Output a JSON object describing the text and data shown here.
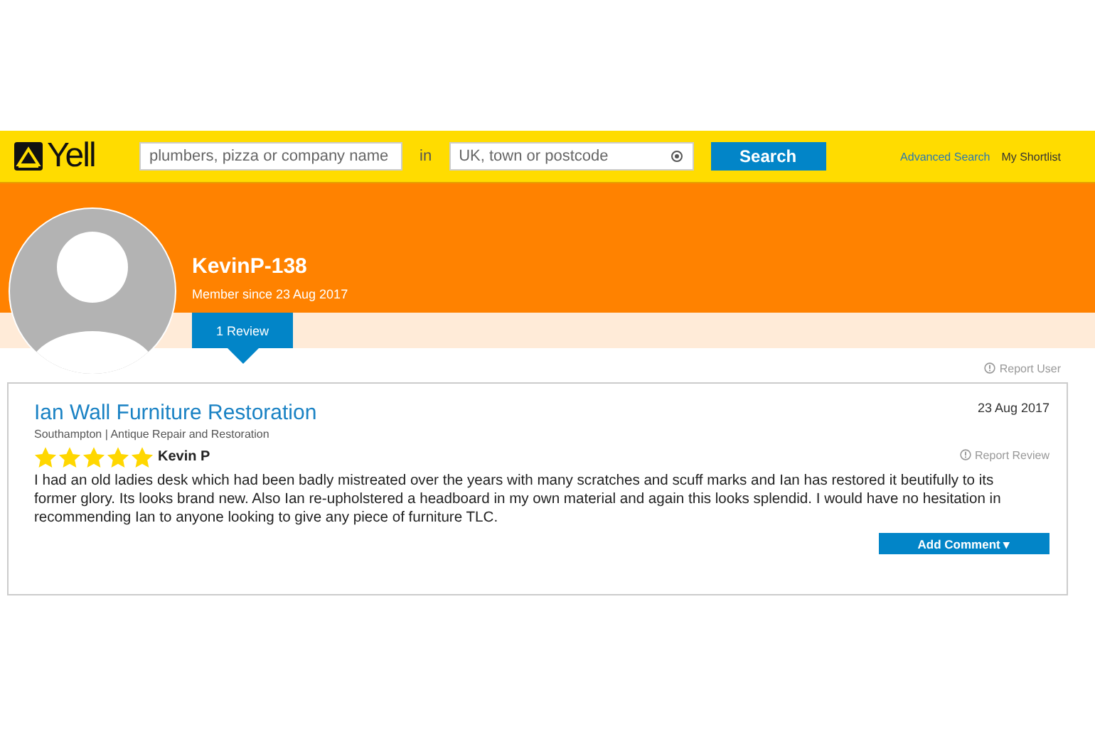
{
  "header": {
    "logo": "Yell",
    "what_field": {
      "placeholder": "plumbers, pizza or company name"
    },
    "in_label": "in",
    "where_field": {
      "placeholder": "UK, town or postcode"
    },
    "search_button": "Search",
    "links": [
      "Advanced Search",
      "My Shortlist"
    ]
  },
  "profile": {
    "username": "KevinP-138",
    "member_since": "Member since 23 Aug 2017"
  },
  "tabs": [
    {
      "label": "1 Review",
      "selected": true
    }
  ],
  "report_user": "Report User",
  "review": {
    "business": "Ian Wall Furniture Restoration",
    "location": "Southampton",
    "separator": "|",
    "category": "Antique Repair and Restoration",
    "date": "23 Aug 2017",
    "stars": 5,
    "author": "Kevin P",
    "report": "Report Review",
    "text": "I had an old ladies desk which had been badly mistreated over the years with many scratches and scuff marks and Ian has restored it beutifully to its former glory. Its looks brand new. Also Ian re-upholstered a headboard in my own material and again this looks splendid. I would have no hesitation in recommending Ian to anyone looking to give any piece of furniture TLC.",
    "add_comment": "Add Comment ▾"
  }
}
